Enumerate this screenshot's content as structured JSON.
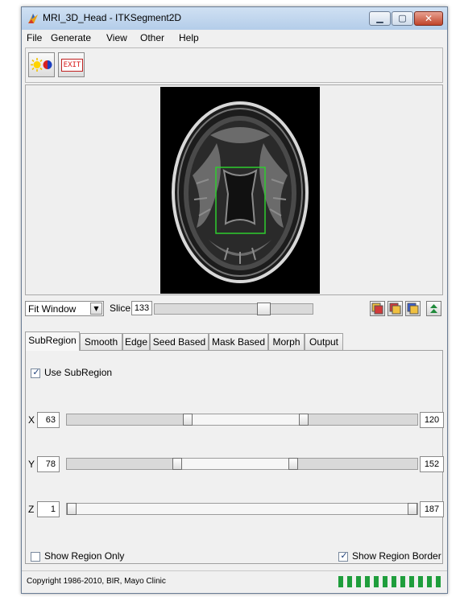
{
  "window": {
    "title": "MRI_3D_Head - ITKSegment2D",
    "controls": {
      "minimize": "▁",
      "maximize": "▢",
      "close": "✕"
    }
  },
  "menu": [
    "File",
    "Generate",
    "View",
    "Other",
    "Help"
  ],
  "toolbar": {
    "exit_label": "EXIT"
  },
  "viewer": {
    "zoom_mode": "Fit Window",
    "slice_label": "Slice",
    "slice_value": "133",
    "slice_level": 0.71
  },
  "tabs": [
    "SubRegion",
    "Smooth",
    "Edge",
    "Seed Based",
    "Mask Based",
    "Morph",
    "Output"
  ],
  "active_tab": "SubRegion",
  "subregion": {
    "use_label": "Use SubRegion",
    "use_checked": true,
    "axes": [
      {
        "label": "X",
        "min_value": "63",
        "max_value": "120",
        "range": [
          0.34,
          0.68
        ]
      },
      {
        "label": "Y",
        "min_value": "78",
        "max_value": "152",
        "range": [
          0.31,
          0.65
        ]
      },
      {
        "label": "Z",
        "min_value": "1",
        "max_value": "187",
        "range": [
          0.0,
          1.0
        ]
      }
    ],
    "show_region_only_label": "Show Region Only",
    "show_region_only_checked": false,
    "show_region_border_label": "Show Region Border",
    "show_region_border_checked": true
  },
  "status": {
    "copyright": "Copyright 1986-2010, BIR, Mayo Clinic",
    "progress_segments": 12
  },
  "colors": {
    "region_box": "#2ecc2e",
    "progress": "#1f9e3c",
    "exit": "#d81818"
  }
}
